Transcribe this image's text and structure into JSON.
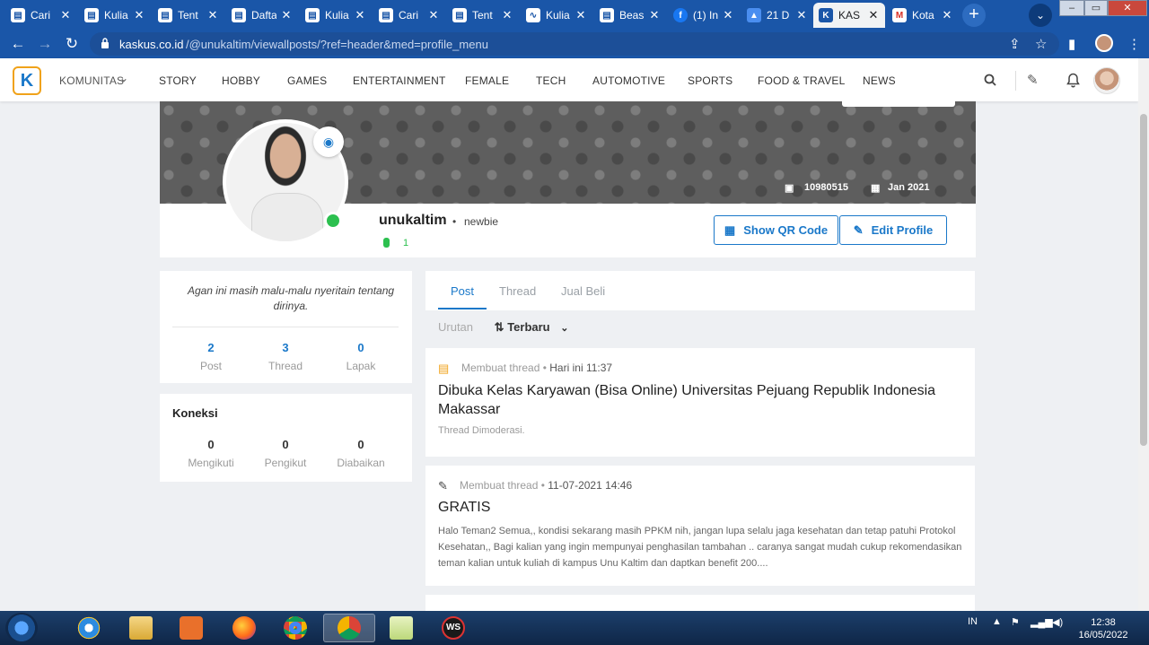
{
  "browser": {
    "tabs": [
      {
        "title": "Cari",
        "favicon": "page-icon",
        "active": false
      },
      {
        "title": "Kulia",
        "favicon": "page-icon",
        "active": false
      },
      {
        "title": "Tent",
        "favicon": "page-icon",
        "active": false
      },
      {
        "title": "Dafta",
        "favicon": "page-icon",
        "active": false
      },
      {
        "title": "Kulia",
        "favicon": "page-icon",
        "active": false
      },
      {
        "title": "Cari",
        "favicon": "page-icon",
        "active": false
      },
      {
        "title": "Tent",
        "favicon": "page-icon",
        "active": false
      },
      {
        "title": "Kulia",
        "favicon": "wave-icon",
        "active": false
      },
      {
        "title": "Beas",
        "favicon": "page-icon",
        "active": false
      },
      {
        "title": "(1) In",
        "favicon": "facebook-icon",
        "active": false
      },
      {
        "title": "21 D",
        "favicon": "drive-icon",
        "active": false
      },
      {
        "title": "KAS",
        "favicon": "kaskus-icon",
        "active": true
      },
      {
        "title": "Kota",
        "favicon": "gmail-icon",
        "active": false
      }
    ],
    "new_tab": "+",
    "url_host": "kaskus.co.id",
    "url_path": "/@unukaltim/viewallposts/?ref=header&med=profile_menu"
  },
  "nav": {
    "items": [
      "KOMUNITAS",
      "STORY",
      "HOBBY",
      "GAMES",
      "ENTERTAINMENT",
      "FEMALE",
      "TECH",
      "AUTOMOTIVE",
      "SPORTS",
      "FOOD & TRAVEL",
      "NEWS"
    ]
  },
  "profile": {
    "username": "unukaltim",
    "rank": "newbie",
    "reputation": "1",
    "user_id": "10980515",
    "join_date": "Jan 2021",
    "show_qr_label": "Show QR Code",
    "edit_profile_label": "Edit Profile",
    "about": "Agan ini masih malu-malu nyeritain tentang dirinya.",
    "stats": [
      {
        "value": "2",
        "label": "Post"
      },
      {
        "value": "3",
        "label": "Thread"
      },
      {
        "value": "0",
        "label": "Lapak"
      }
    ],
    "connections_title": "Koneksi",
    "connections": [
      {
        "value": "0",
        "label": "Mengikuti"
      },
      {
        "value": "0",
        "label": "Pengikut"
      },
      {
        "value": "0",
        "label": "Diabaikan"
      }
    ]
  },
  "content": {
    "tabs": [
      "Post",
      "Thread",
      "Jual Beli"
    ],
    "sort_label": "Urutan",
    "sort_value": "Terbaru",
    "posts": [
      {
        "action": "Membuat thread",
        "time": "Hari ini 11:37",
        "title": "Dibuka Kelas Karyawan (Bisa Online) Universitas Pejuang Republik Indonesia Makassar",
        "body": "Thread Dimoderasi."
      },
      {
        "action": "Membuat thread",
        "time": "11-07-2021 14:46",
        "title": "GRATIS",
        "body": "Halo Teman2 Semua,, kondisi sekarang masih PPKM nih, jangan lupa selalu jaga kesehatan dan tetap patuhi Protokol Kesehatan,,  Bagi kalian yang ingin mempunyai penghasilan tambahan .. caranya sangat mudah cukup rekomendasikan teman kalian untuk kuliah di kampus Unu Kaltim dan daptkan benefit 200...."
      }
    ]
  },
  "taskbar": {
    "apps": [
      "ie-icon",
      "file-explorer-icon",
      "media-player-icon",
      "firefox-icon",
      "chrome-icon",
      "chrome-icon",
      "folder-icon",
      "ws-icon"
    ],
    "ws_label": "WS",
    "lang": "IN",
    "time": "12:38",
    "date": "16/05/2022"
  },
  "colors": {
    "browser_blue": "#1a56a8",
    "kaskus_blue": "#1a78c9",
    "online_green": "#2cc04f",
    "logo_orange": "#f0a21a"
  }
}
